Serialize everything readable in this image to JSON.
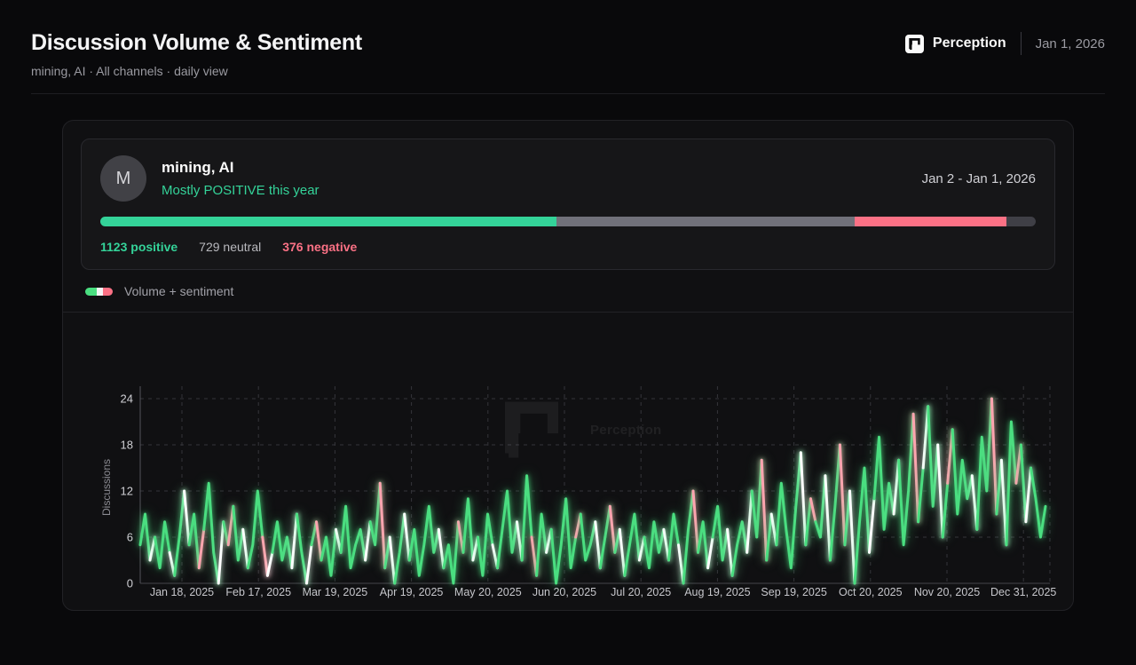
{
  "header": {
    "title": "Discussion Volume & Sentiment",
    "subtitle": "mining, AI · All channels · daily view",
    "brand": "Perception",
    "date": "Jan 1, 2026"
  },
  "summary": {
    "avatar_letter": "M",
    "name": "mining, AI",
    "sentiment_label": "Mostly POSITIVE this year",
    "date_range": "Jan 2 - Jan 1, 2026",
    "bar": [
      {
        "name": "positive",
        "color": "#34d399",
        "pct": 48.8
      },
      {
        "name": "neutral",
        "color": "#71717a",
        "pct": 31.8
      },
      {
        "name": "negative",
        "color": "#fb7185",
        "pct": 16.3
      },
      {
        "name": "remainder",
        "color": "#3f3f46",
        "pct": 3.1
      }
    ],
    "stats": [
      {
        "count": "1123",
        "label": "positive"
      },
      {
        "count": "729",
        "label": "neutral"
      },
      {
        "count": "376",
        "label": "negative"
      }
    ]
  },
  "legend": {
    "label": "Volume + sentiment",
    "swatch_colors": [
      "#4ade80",
      "#f4f4f5",
      "#fb7185"
    ],
    "swatch_widths": [
      42,
      24,
      34
    ]
  },
  "watermark": {
    "text": "Perception"
  },
  "chart_data": {
    "type": "line",
    "title": "Volume + sentiment",
    "ylabel": "Discussions",
    "yticks": [
      0,
      6,
      12,
      18,
      24
    ],
    "ylim": [
      0,
      24
    ],
    "x_range": [
      "Jan 2, 2025",
      "Jan 1, 2026"
    ],
    "xtick_labels": [
      "Jan 18, 2025",
      "Feb 17, 2025",
      "Mar 19, 2025",
      "Apr 19, 2025",
      "May 20, 2025",
      "Jun 20, 2025",
      "Jul 20, 2025",
      "Aug 19, 2025",
      "Sep 19, 2025",
      "Oct 20, 2025",
      "Nov 20, 2025",
      "Dec 31, 2025"
    ],
    "grid": "dashed",
    "legend_position": "top-left",
    "sampling": "approx. every 2 days, Jan 2 2025 - Jan 1 2026",
    "values": [
      5,
      9,
      3,
      6,
      2,
      8,
      4,
      1,
      6,
      12,
      5,
      9,
      2,
      7,
      13,
      4,
      0,
      8,
      5,
      10,
      3,
      7,
      2,
      5,
      12,
      6,
      1,
      4,
      8,
      3,
      6,
      2,
      9,
      4,
      0,
      5,
      8,
      3,
      6,
      1,
      7,
      4,
      10,
      2,
      5,
      7,
      3,
      8,
      5,
      13,
      2,
      6,
      0,
      4,
      9,
      3,
      7,
      1,
      5,
      10,
      4,
      7,
      2,
      5,
      0,
      8,
      4,
      11,
      3,
      6,
      1,
      9,
      5,
      2,
      7,
      12,
      4,
      8,
      3,
      14,
      6,
      1,
      9,
      4,
      7,
      0,
      5,
      11,
      2,
      6,
      9,
      3,
      5,
      8,
      2,
      6,
      10,
      4,
      7,
      1,
      5,
      9,
      3,
      6,
      2,
      8,
      4,
      7,
      3,
      9,
      5,
      0,
      7,
      12,
      4,
      8,
      2,
      6,
      10,
      3,
      7,
      1,
      5,
      8,
      4,
      12,
      6,
      16,
      3,
      9,
      5,
      13,
      7,
      2,
      10,
      17,
      5,
      11,
      8,
      6,
      14,
      3,
      10,
      18,
      5,
      12,
      0,
      8,
      15,
      4,
      11,
      19,
      7,
      13,
      9,
      16,
      5,
      12,
      22,
      8,
      15,
      23,
      10,
      18,
      6,
      13,
      20,
      9,
      16,
      11,
      14,
      7,
      19,
      12,
      24,
      9,
      16,
      5,
      21,
      13,
      18,
      8,
      15,
      11,
      6,
      10
    ],
    "sentiment_colors": "ggwgggwggwggpgggwgpggwgggpwggggwggwgpgggwgggggwggpgwggwggggggwgggpggwgggwggggwggpggwgggggpgggwggpgwgggwggggwggwggpggwgggwgggwggpgwgggggwgpggwggpgwgggwggggwgggpgwggwgpggggwgggpgwggpgwggg",
    "color_map": {
      "g": "#4ade80",
      "w": "#ffffff",
      "p": "#fda4af"
    }
  }
}
